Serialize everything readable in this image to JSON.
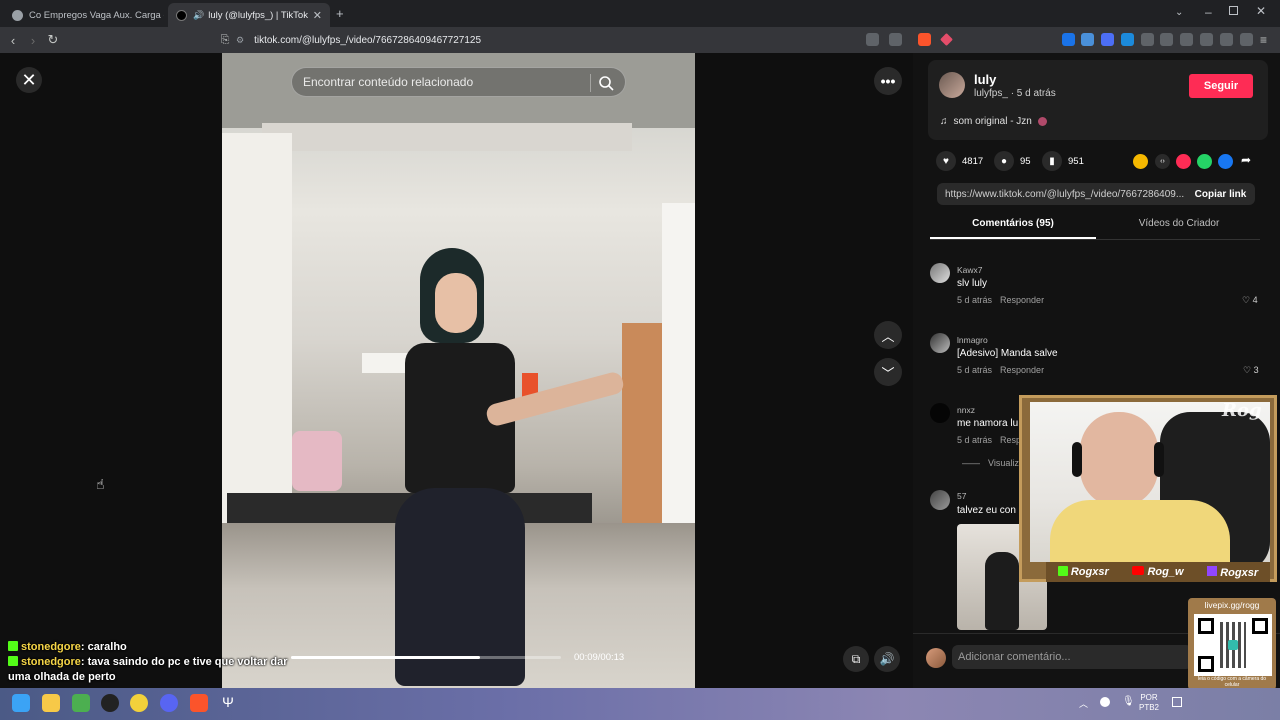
{
  "browser": {
    "tabs": [
      {
        "label": "Co Empregos Vaga Aux. Carga e des"
      },
      {
        "label": "luly (@lulyfps_) | TikTok"
      }
    ],
    "url": "tiktok.com/@lulyfps_/video/7667286409467727125"
  },
  "video": {
    "search_placeholder": "Encontrar conteúdo relacionado",
    "time": "00:09/00:13",
    "progress": 0.7
  },
  "author": {
    "name": "luly",
    "handle": "lulyfps_",
    "posted": "5 d atrás",
    "follow_label": "Seguir",
    "music": "som original - Jzn"
  },
  "stats": {
    "likes": "4817",
    "comments": "95",
    "saves": "951"
  },
  "link": {
    "text": "https://www.tiktok.com/@lulyfps_/video/7667286409...",
    "copy_label": "Copiar link"
  },
  "panel_tabs": {
    "comments": "Comentários (95)",
    "creator_videos": "Vídeos do Criador"
  },
  "comments": [
    {
      "user": "Kawx7",
      "text": "slv luly",
      "time": "5 d atrás",
      "reply": "Responder",
      "likes": "4"
    },
    {
      "user": "lnmagro",
      "text": "[Adesivo] Manda salve",
      "time": "5 d atrás",
      "reply": "Responder",
      "likes": "3"
    },
    {
      "user": "nnxz",
      "text": "me namora lu",
      "time": "5 d atrás",
      "reply": "Resp",
      "view": "Visualiza"
    },
    {
      "user": "57",
      "text": "talvez eu con"
    }
  ],
  "comment_input": {
    "placeholder": "Adicionar comentário..."
  },
  "stream": {
    "socials": [
      {
        "name": "Rogxsr"
      },
      {
        "name": "Rog_w"
      },
      {
        "name": "Rogxsr"
      }
    ],
    "logo": "Rog",
    "pix": "livepix.gg/rogg",
    "qr_caption": "leia o código com a câmera do celular",
    "chat": [
      {
        "user": "stonedgore",
        "msg": "caralho"
      },
      {
        "user": "stonedgore",
        "msg": "tava saindo do pc e tive que voltar dar uma olhada de perto"
      }
    ]
  },
  "taskbar": {
    "lang": "POR",
    "layout": "PTB2"
  }
}
